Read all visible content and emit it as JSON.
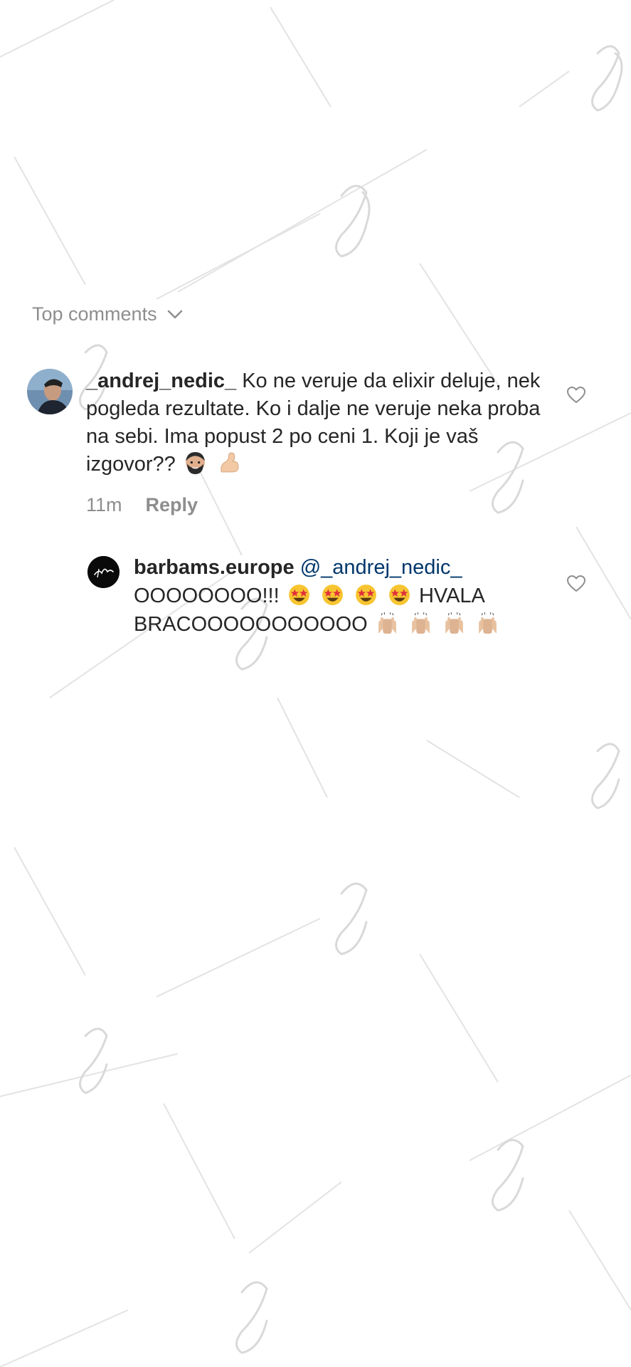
{
  "comments_section": {
    "header_label": "Top comments"
  },
  "comments": [
    {
      "username": "_andrej_nedic_",
      "text": "Ko ne veruje da elixir deluje, nek pogleda rezultate. Ko i dalje ne veruje neka proba na sebi. Ima popust 2 po ceni 1. Koji je vaš izgovor??",
      "emojis": [
        "bearded-man-emoji",
        "flexed-biceps-emoji"
      ],
      "time": "11m",
      "reply_label": "Reply"
    },
    {
      "username": "barbams.europe",
      "mention": "@_andrej_nedic_",
      "text_part1": "OOOOOOOO!!!",
      "emojis_part1": [
        "star-struck-emoji",
        "star-struck-emoji",
        "star-struck-emoji",
        "star-struck-emoji"
      ],
      "text_part2": "HVALA BRACOOOOOOOOOOO",
      "emojis_part2": [
        "raising-hands-emoji",
        "raising-hands-emoji",
        "raising-hands-emoji",
        "raising-hands-emoji"
      ]
    }
  ],
  "watermark": {
    "text": "Barbams",
    "color": "#d9d9d9"
  },
  "colors": {
    "primary_text": "#262626",
    "secondary_text": "#8e8e8e",
    "mention": "#00376b"
  }
}
